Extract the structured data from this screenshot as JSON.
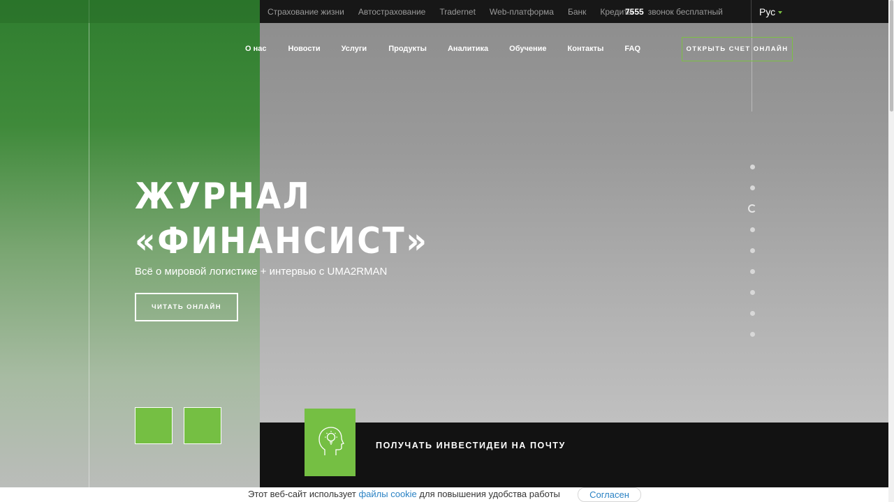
{
  "topbar": {
    "links": [
      "Страхование жизни",
      "Автострахование",
      "Tradernet",
      "Web-платформа",
      "Банк",
      "Кредиты"
    ],
    "phone_number": "7555",
    "phone_text": "звонок бесплатный",
    "language": "Рус"
  },
  "nav": {
    "items": [
      "О нас",
      "Новости",
      "Услуги",
      "Продукты",
      "Аналитика",
      "Обучение",
      "Контакты",
      "FAQ"
    ],
    "cta": "ОТКРЫТЬ СЧЕТ ОНЛАЙН"
  },
  "hero": {
    "title_line1": "ЖУРНАЛ",
    "title_line2": "«ФИНАНСИСТ»",
    "subtitle": "Всё о мировой логистике + интервью с UMA2RMAN",
    "button": "ЧИТАТЬ ОНЛАЙН"
  },
  "slider": {
    "count": 9,
    "active_index": 2
  },
  "subscribe": {
    "label": "ПОЛУЧАТЬ ИНВЕСТИДЕИ НА ПОЧТУ",
    "icon": "lightbulb-head-icon"
  },
  "cookie": {
    "text_before": "Этот веб-сайт использует ",
    "link": "файлы cookie",
    "text_after": " для повышения удобства работы",
    "button": "Согласен"
  },
  "colors": {
    "accent": "#75bf43",
    "topbar": "#171717",
    "band": "#121212",
    "link": "#2a82c4"
  }
}
